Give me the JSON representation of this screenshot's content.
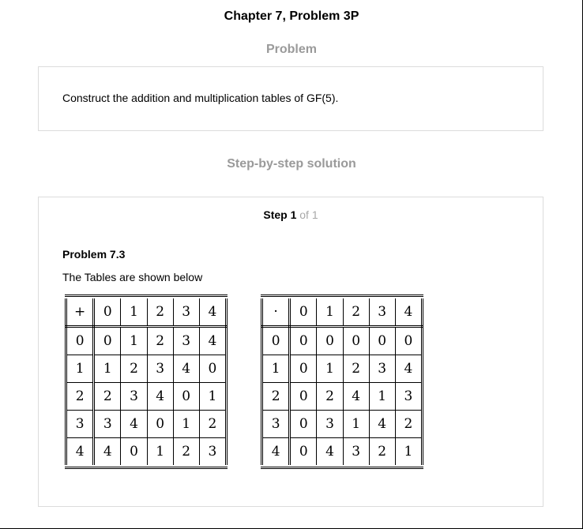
{
  "header": {
    "chapter_title": "Chapter 7, Problem 3P",
    "problem_heading": "Problem",
    "solution_heading": "Step-by-step solution"
  },
  "problem": {
    "text": "Construct the addition and multiplication tables of GF(5)."
  },
  "solution": {
    "step_word": "Step 1",
    "step_of": "of 1",
    "subproblem_title": "Problem 7.3",
    "intro_text": "The Tables are shown below"
  },
  "tables": {
    "addition": {
      "operator": "+",
      "columns": [
        "0",
        "1",
        "2",
        "3",
        "4"
      ],
      "rows": [
        [
          "0",
          "0",
          "1",
          "2",
          "3",
          "4"
        ],
        [
          "1",
          "1",
          "2",
          "3",
          "4",
          "0"
        ],
        [
          "2",
          "2",
          "3",
          "4",
          "0",
          "1"
        ],
        [
          "3",
          "3",
          "4",
          "0",
          "1",
          "2"
        ],
        [
          "4",
          "4",
          "0",
          "1",
          "2",
          "3"
        ]
      ]
    },
    "multiplication": {
      "operator": "·",
      "columns": [
        "0",
        "1",
        "2",
        "3",
        "4"
      ],
      "rows": [
        [
          "0",
          "0",
          "0",
          "0",
          "0",
          "0"
        ],
        [
          "1",
          "0",
          "1",
          "2",
          "3",
          "4"
        ],
        [
          "2",
          "0",
          "2",
          "4",
          "1",
          "3"
        ],
        [
          "3",
          "0",
          "3",
          "1",
          "4",
          "2"
        ],
        [
          "4",
          "0",
          "4",
          "3",
          "2",
          "1"
        ]
      ]
    }
  }
}
